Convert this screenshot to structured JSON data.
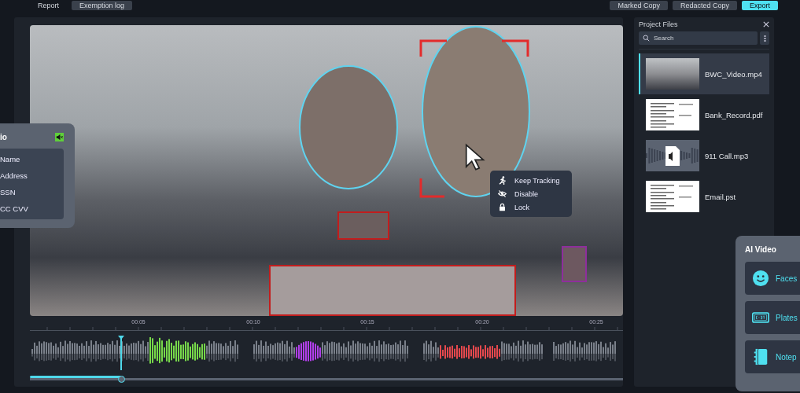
{
  "top_bar": {
    "tabs": [
      {
        "label": "Report",
        "selected": false
      },
      {
        "label": "Exemption log",
        "selected": true
      }
    ],
    "buttons": [
      {
        "label": "Marked Copy",
        "kind": "secondary"
      },
      {
        "label": "Redacted Copy",
        "kind": "secondary"
      },
      {
        "label": "Export",
        "kind": "primary"
      }
    ]
  },
  "context_menu": {
    "items": [
      {
        "label": "Keep Tracking",
        "kind": "track"
      },
      {
        "label": "Disable",
        "kind": "disable"
      },
      {
        "label": "Lock",
        "kind": "lock"
      }
    ]
  },
  "audio_panel": {
    "title": "io",
    "muted": true,
    "items": [
      "Name",
      "Address",
      "SSN",
      "CC CVV"
    ]
  },
  "timeline": {
    "ticks": [
      "00:05",
      "00:10",
      "00:15",
      "00:20",
      "00:25"
    ],
    "level": 0.154
  },
  "project_files": {
    "title": "Project Files",
    "search": {
      "placeholder": "Search"
    },
    "files": [
      {
        "name": "BWC_Video.mp4",
        "kind": "video",
        "selected": true
      },
      {
        "name": "Bank_Record.pdf",
        "kind": "document",
        "selected": false
      },
      {
        "name": "911 Call.mp3",
        "kind": "audio",
        "selected": false
      },
      {
        "name": "Email.pst",
        "kind": "document",
        "selected": false
      }
    ]
  },
  "ai_video": {
    "title": "AI Video",
    "items": [
      {
        "label": "Faces",
        "kind": "faces"
      },
      {
        "label": "Plates",
        "kind": "plates"
      },
      {
        "label": "Notep",
        "kind": "notepad"
      }
    ]
  }
}
